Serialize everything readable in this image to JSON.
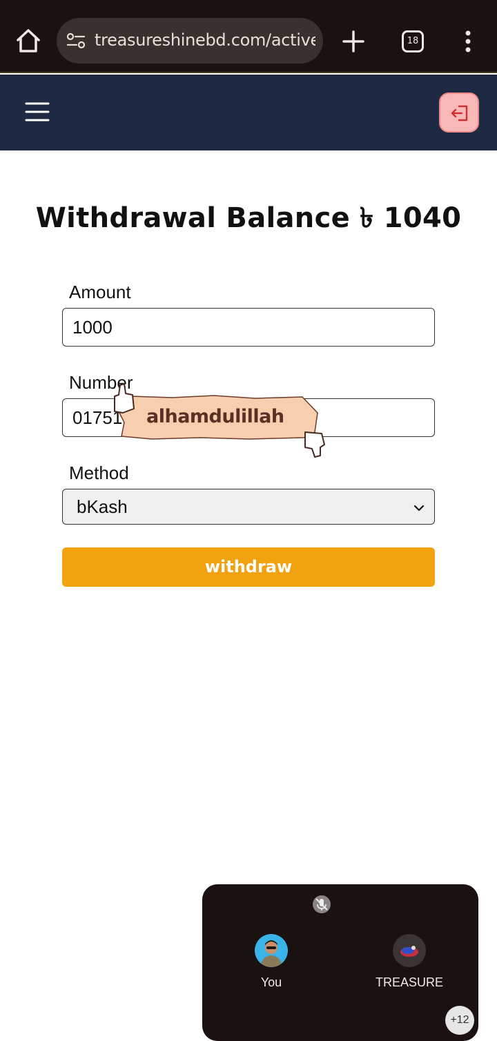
{
  "browser": {
    "url": "treasureshinebd.com/active/u",
    "tab_count": "18"
  },
  "page": {
    "title": "Withdrawal Balance ৳ 1040"
  },
  "form": {
    "amount_label": "Amount",
    "amount_value": "1000",
    "number_label": "Number",
    "number_value": "01751",
    "method_label": "Method",
    "method_value": "bKash",
    "submit_label": "withdraw"
  },
  "sticker": {
    "text": "alhamdulillah"
  },
  "call": {
    "participants": [
      {
        "name": "You"
      },
      {
        "name": "TREASURE"
      }
    ],
    "more_count": "+12"
  },
  "colors": {
    "browser_bg": "#1b1210",
    "header_bg": "#1e2a44",
    "accent_button": "#f2a20f",
    "logout_bg": "#f9b8b8",
    "call_panel_bg": "#1a1110"
  }
}
